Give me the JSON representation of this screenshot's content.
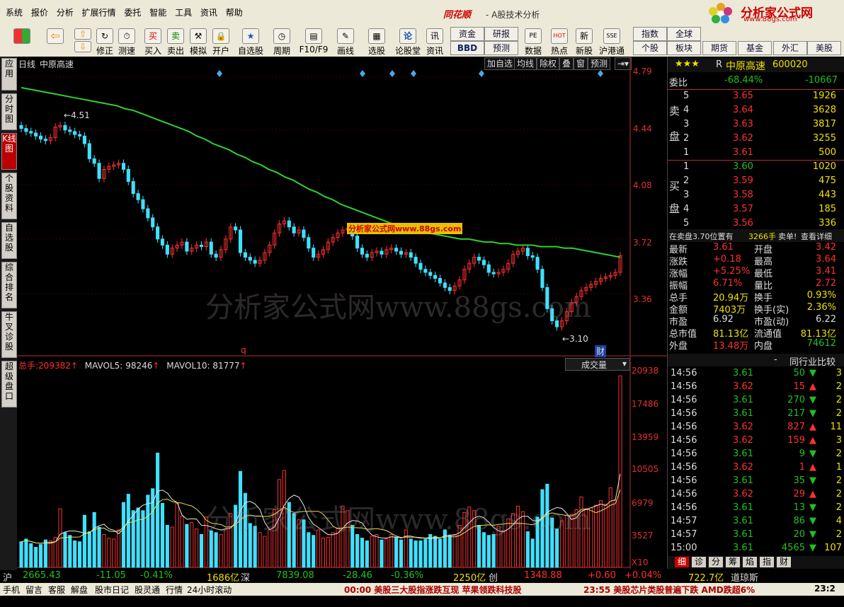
{
  "menu": [
    "系统",
    "报价",
    "分析",
    "扩展行情",
    "委托",
    "智能",
    "工具",
    "资讯",
    "帮助"
  ],
  "title": {
    "logo": "同花顺",
    "subtitle": "- A股技术分析"
  },
  "brand": {
    "name": "分析家公式网",
    "url": "www.88gs.com"
  },
  "toolbar": [
    {
      "label": "修正",
      "icon": "↻"
    },
    {
      "label": "测速",
      "icon": "⏱"
    },
    {
      "label": "买入",
      "icon": "买"
    },
    {
      "label": "卖出",
      "icon": "卖"
    },
    {
      "label": "模拟",
      "icon": "⚒"
    },
    {
      "label": "开户",
      "icon": "🔒"
    },
    {
      "label": "自选股",
      "icon": "★"
    },
    {
      "label": "周期",
      "icon": "◷"
    },
    {
      "label": "F10/F9",
      "icon": "▤"
    },
    {
      "label": "画线",
      "icon": "✎"
    },
    {
      "label": "选股",
      "icon": "▦"
    },
    {
      "label": "论股堂",
      "icon": "论"
    },
    {
      "label": "资讯",
      "icon": "讯"
    },
    {
      "label": "数据",
      "icon": "PE"
    },
    {
      "label": "热点",
      "icon": "HOT"
    },
    {
      "label": "新股",
      "icon": "新"
    },
    {
      "label": "沪港通",
      "icon": "SSE"
    }
  ],
  "toolbar_buttons": [
    "资金",
    "研报",
    "BBD",
    "预测",
    "指数",
    "全球",
    "个股",
    "板块",
    "期货",
    "基金",
    "外汇",
    "美股"
  ],
  "left_tabs": [
    "应用",
    "分时图",
    "K线图",
    "个股资料",
    "自选股",
    "综合排名",
    "牛叉诊股",
    "超级盘口"
  ],
  "chart_header": {
    "period": "日线",
    "stock": "中原高速",
    "tabs": [
      "加自选",
      "均线",
      "除权",
      "叠",
      "窗",
      "预测"
    ]
  },
  "price_axis": [
    "4.79",
    "4.44",
    "4.08",
    "3.72",
    "3.36"
  ],
  "annotations": {
    "high": "4.51",
    "low": "3.10",
    "q": "q",
    "cai": "财",
    "mid_watermark": "分析家公式网www.88gs.com"
  },
  "watermark": "分析家公式网www.88gs.com",
  "vol_header": {
    "total_label": "总手:",
    "total": "209382",
    "mavol5_label": "MAVOL5:",
    "mavol5": "98246",
    "mavol10_label": "MAVOL10:",
    "mavol10": "81777",
    "selector": "成交量"
  },
  "vol_axis": [
    "20938",
    "17486",
    "13959",
    "10505",
    "6979",
    "3527",
    "X10"
  ],
  "chart_data": {
    "type": "candlestick",
    "price_ylim": [
      3.0,
      4.85
    ],
    "ma_line": [
      4.72,
      4.71,
      4.7,
      4.69,
      4.68,
      4.67,
      4.66,
      4.65,
      4.64,
      4.63,
      4.62,
      4.61,
      4.6,
      4.58,
      4.57,
      4.55,
      4.53,
      4.51,
      4.49,
      4.47,
      4.45,
      4.43,
      4.4,
      4.38,
      4.35,
      4.33,
      4.31,
      4.28,
      4.26,
      4.23,
      4.21,
      4.18,
      4.16,
      4.13,
      4.11,
      4.08,
      4.05,
      4.03,
      4.0,
      3.98,
      3.95,
      3.93,
      3.91,
      3.89,
      3.87,
      3.85,
      3.83,
      3.81,
      3.8,
      3.78,
      3.77,
      3.76,
      3.75,
      3.74,
      3.73,
      3.72,
      3.72,
      3.71,
      3.7,
      3.7,
      3.69,
      3.69,
      3.68,
      3.68,
      3.68,
      3.67,
      3.67,
      3.67,
      3.66,
      3.66,
      3.65,
      3.64,
      3.63,
      3.62,
      3.61,
      3.6
    ],
    "closes": [
      4.45,
      4.43,
      4.42,
      4.4,
      4.38,
      4.37,
      4.39,
      4.46,
      4.47,
      4.44,
      4.43,
      4.41,
      4.4,
      4.35,
      4.25,
      4.22,
      4.12,
      4.18,
      4.2,
      4.21,
      4.22,
      4.18,
      4.1,
      4.02,
      3.98,
      3.92,
      3.86,
      3.8,
      3.72,
      3.68,
      3.62,
      3.66,
      3.68,
      3.7,
      3.64,
      3.66,
      3.68,
      3.67,
      3.7,
      3.62,
      3.6,
      3.65,
      3.72,
      3.8,
      3.78,
      3.63,
      3.6,
      3.58,
      3.56,
      3.58,
      3.63,
      3.68,
      3.76,
      3.82,
      3.84,
      3.8,
      3.76,
      3.78,
      3.73,
      3.66,
      3.6,
      3.62,
      3.65,
      3.7,
      3.73,
      3.76,
      3.78,
      3.79,
      3.74,
      3.66,
      3.62,
      3.6,
      3.63,
      3.64,
      3.62,
      3.65,
      3.66,
      3.64,
      3.62,
      3.63,
      3.6,
      3.56,
      3.52,
      3.5,
      3.48,
      3.46,
      3.43,
      3.4,
      3.38,
      3.41,
      3.45,
      3.52,
      3.56,
      3.6,
      3.58,
      3.55,
      3.5,
      3.49,
      3.5,
      3.52,
      3.56,
      3.62,
      3.64,
      3.66,
      3.61,
      3.6,
      3.52,
      3.4,
      3.26,
      3.18,
      3.14,
      3.18,
      3.24,
      3.3,
      3.34,
      3.38,
      3.4,
      3.42,
      3.44,
      3.46,
      3.47,
      3.48,
      3.5,
      3.61
    ],
    "volumes": [
      2800,
      3100,
      2600,
      2200,
      2500,
      3000,
      2900,
      3300,
      6400,
      3800,
      3500,
      2900,
      2800,
      5700,
      3900,
      6000,
      4400,
      3600,
      3200,
      3100,
      4100,
      7100,
      8000,
      6200,
      6500,
      6200,
      7900,
      8600,
      12500,
      7000,
      4600,
      4400,
      7000,
      5600,
      4700,
      4900,
      4200,
      3600,
      5500,
      4000,
      3800,
      3600,
      4200,
      5900,
      6800,
      10500,
      8100,
      4800,
      4500,
      3800,
      3400,
      4100,
      6300,
      9600,
      10600,
      7100,
      5900,
      5200,
      5200,
      3800,
      3500,
      4100,
      3200,
      3300,
      3800,
      4300,
      6700,
      6200,
      4600,
      3600,
      3200,
      2900,
      3400,
      3600,
      3000,
      3100,
      3600,
      3300,
      3000,
      4100,
      3100,
      2900,
      2900,
      3100,
      3600,
      3400,
      3100,
      4100,
      3500,
      3600,
      4600,
      6000,
      6600,
      6200,
      4600,
      3800,
      3500,
      3600,
      4500,
      4000,
      5300,
      5900,
      6700,
      6100,
      3900,
      3100,
      5500,
      8500,
      9100,
      5400,
      4200,
      5100,
      5700,
      5800,
      6300,
      7700,
      6300,
      6500,
      6800,
      7300,
      6900,
      8700,
      7300,
      20938
    ],
    "mavol5_label": "98246",
    "mavol10_label": "81777"
  },
  "quote": {
    "stars": "★★★",
    "r": "R",
    "name": "中原高速",
    "code": "600020",
    "weibi_label": "委比",
    "weibi": "-68.44%",
    "weicha": "-10667",
    "sell_label": [
      "卖",
      "盘"
    ],
    "buy_label": [
      "买",
      "盘"
    ],
    "sell": [
      {
        "lv": "5",
        "p": "3.65",
        "v": "1926"
      },
      {
        "lv": "4",
        "p": "3.64",
        "v": "3628"
      },
      {
        "lv": "3",
        "p": "3.63",
        "v": "3817"
      },
      {
        "lv": "2",
        "p": "3.62",
        "v": "3255"
      },
      {
        "lv": "1",
        "p": "3.61",
        "v": "500"
      }
    ],
    "buy": [
      {
        "lv": "1",
        "p": "3.60",
        "v": "1020"
      },
      {
        "lv": "2",
        "p": "3.59",
        "v": "475"
      },
      {
        "lv": "3",
        "p": "3.58",
        "v": "443"
      },
      {
        "lv": "4",
        "p": "3.57",
        "v": "185"
      },
      {
        "lv": "5",
        "p": "3.56",
        "v": "336"
      }
    ],
    "info_left": "在卖盘3.70位置有",
    "info_mid": "3266手",
    "info_right1": "卖单!",
    "info_right2": "查看详细",
    "stats": [
      {
        "l1": "最新",
        "v1": "3.61",
        "c1": "red",
        "l2": "开盘",
        "v2": "3.42",
        "c2": "red"
      },
      {
        "l1": "涨跌",
        "v1": "+0.18",
        "c1": "red",
        "l2": "最高",
        "v2": "3.64",
        "c2": "red"
      },
      {
        "l1": "涨幅",
        "v1": "+5.25%",
        "c1": "red",
        "l2": "最低",
        "v2": "3.41",
        "c2": "red"
      },
      {
        "l1": "振幅",
        "v1": "6.71%",
        "c1": "red",
        "l2": "量比",
        "v2": "2.72",
        "c2": "red"
      },
      {
        "l1": "总手",
        "v1": "20.94万",
        "c1": "yellow",
        "l2": "换手",
        "v2": "0.93%",
        "c2": "yellow"
      },
      {
        "l1": "金额",
        "v1": "7403万",
        "c1": "yellow",
        "l2": "换手(实)",
        "v2": "2.36%",
        "c2": "yellow"
      },
      {
        "l1": "市盈",
        "v1": "6.92",
        "c1": "white",
        "l2": "市盈(动)",
        "v2": "6.22",
        "c2": "white"
      },
      {
        "l1": "总市值",
        "v1": "81.13亿",
        "c1": "yellow",
        "l2": "流通值",
        "v2": "81.13亿",
        "c2": "yellow"
      },
      {
        "l1": "外盘",
        "v1": "13.48万",
        "c1": "red",
        "l2": "内盘",
        "v2": "74612",
        "c2": "green"
      }
    ],
    "ticks_header": {
      "dash": "-",
      "label": "同行业比较"
    },
    "ticks": [
      {
        "t": "14:56",
        "p": "3.61",
        "v": "50",
        "d": "down",
        "n": "3"
      },
      {
        "t": "14:56",
        "p": "3.62",
        "v": "15",
        "d": "up",
        "n": "2"
      },
      {
        "t": "14:56",
        "p": "3.61",
        "v": "270",
        "d": "down",
        "n": "2"
      },
      {
        "t": "14:56",
        "p": "3.61",
        "v": "217",
        "d": "down",
        "n": "2"
      },
      {
        "t": "14:56",
        "p": "3.62",
        "v": "827",
        "d": "up",
        "n": "11"
      },
      {
        "t": "14:56",
        "p": "3.62",
        "v": "159",
        "d": "up",
        "n": "3"
      },
      {
        "t": "14:56",
        "p": "3.61",
        "v": "9",
        "d": "down",
        "n": "2"
      },
      {
        "t": "14:56",
        "p": "3.62",
        "v": "1",
        "d": "up",
        "n": "1"
      },
      {
        "t": "14:56",
        "p": "3.61",
        "v": "35",
        "d": "down",
        "n": "2"
      },
      {
        "t": "14:56",
        "p": "3.62",
        "v": "29",
        "d": "up",
        "n": "2"
      },
      {
        "t": "14:56",
        "p": "3.61",
        "v": "13",
        "d": "down",
        "n": "2"
      },
      {
        "t": "14:57",
        "p": "3.61",
        "v": "86",
        "d": "down",
        "n": "4"
      },
      {
        "t": "14:57",
        "p": "3.61",
        "v": "20",
        "d": "down",
        "n": "2"
      },
      {
        "t": "15:00",
        "p": "3.61",
        "v": "4565",
        "d": "down",
        "n": "107"
      }
    ],
    "bottom_tabs": [
      "细",
      "诊",
      "分",
      "筹",
      "焰",
      "指",
      "财"
    ]
  },
  "index_bar": {
    "sh_label": "沪",
    "sh": "2665.43",
    "sh_chg": "-11.05",
    "sh_pct": "-0.41%",
    "sh_amt": "1686亿",
    "sz_label": "深",
    "sz": "7839.08",
    "sz_chg": "-28.46",
    "sz_pct": "-0.36%",
    "sz_amt": "2250亿",
    "cy_label": "创",
    "cy": "1348.88",
    "cy_chg": "+0.60",
    "cy_pct": "+0.04%",
    "cy_amt": "722.7亿",
    "dj_label": "道琼斯"
  },
  "status_bar": {
    "items": [
      "手机",
      "留言",
      "客服",
      "解盘",
      "股市日记",
      "股灵通",
      "行情",
      "24小时滚动"
    ],
    "ticker1": "00:00 美股三大股指涨跌互现 苹果领跌科技股",
    "ticker2": "23:55 美股芯片类股普遍下跌 AMD跌超6%",
    "time": "23:2"
  },
  "colors": {
    "up": "#ff3030",
    "down": "#40e0ff",
    "ma": "#30d030",
    "bg": "#000000"
  }
}
